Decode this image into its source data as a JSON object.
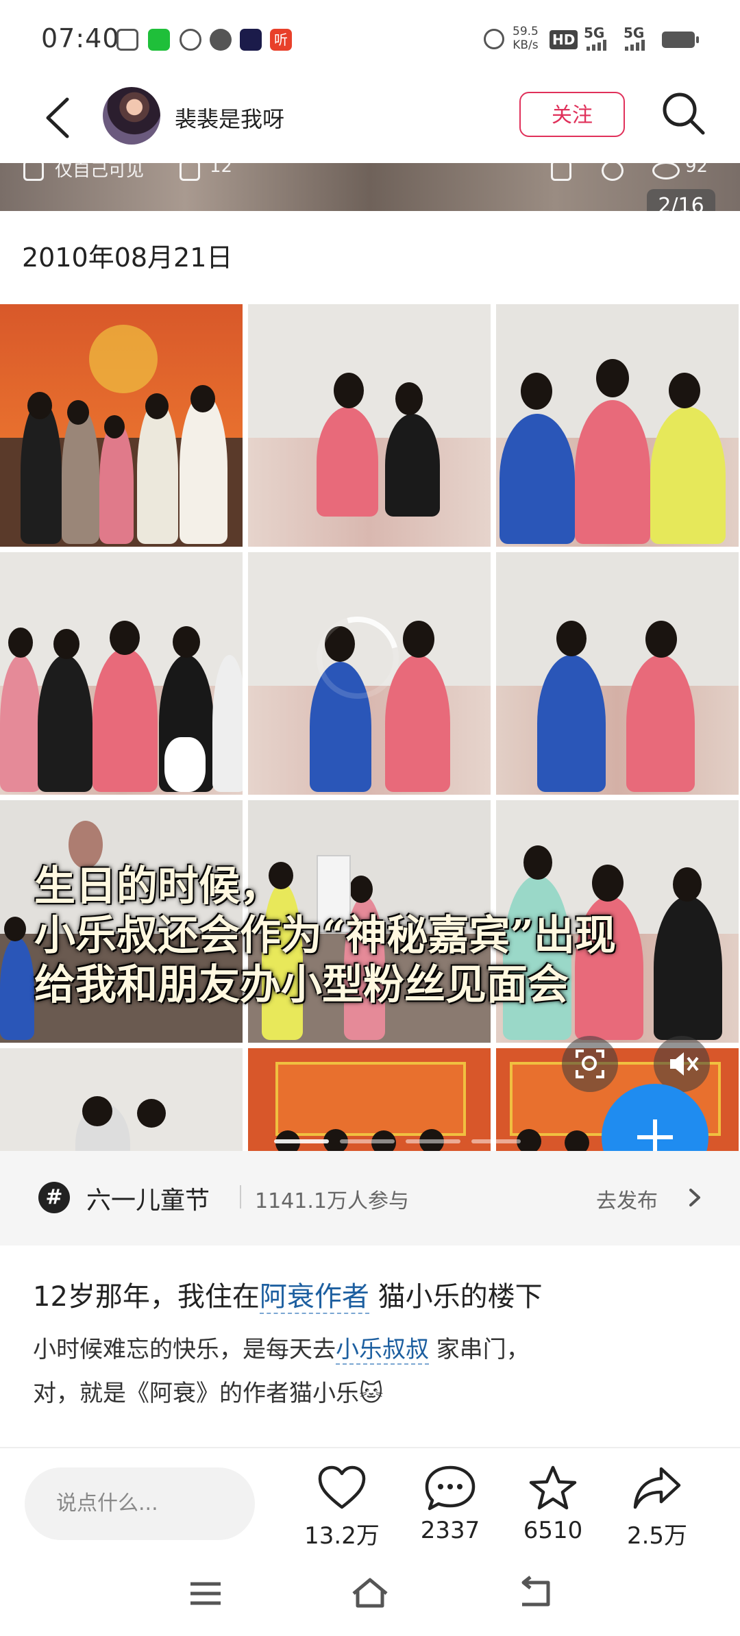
{
  "status_bar": {
    "time": "07:40",
    "net_speed": "59.5",
    "net_speed_unit": "KB/s",
    "hd_label": "HD",
    "signal_1": "5G",
    "signal_2": "5G",
    "listen_badge": "听"
  },
  "header": {
    "username": "裴裴是我呀",
    "follow_label": "关注"
  },
  "previous_post": {
    "visibility": "仅自己可见",
    "count": "12",
    "views": "92"
  },
  "gallery": {
    "counter": "2/16",
    "date": "2010年08月21日",
    "caption_lines": [
      "生日的时候，",
      "小乐叔还会作为“神秘嘉宾”出现",
      "给我和朋友办小型粉丝见面会"
    ]
  },
  "topic": {
    "icon": "#",
    "name": "六一儿童节",
    "participants": "1141.1万人参与",
    "action": "去发布"
  },
  "post": {
    "title_before": "12岁那年，我住在",
    "title_link": "阿衰作者",
    "title_after": " 猫小乐的楼下",
    "body_line1_before": "小时候难忘的快乐，是每天去",
    "body_line1_link": "小乐叔叔",
    "body_line1_after": " 家串门，",
    "body_line2": "对，就是《阿衰》的作者猫小乐🐱"
  },
  "actions": {
    "comment_placeholder": "说点什么...",
    "likes": "13.2万",
    "comments": "2337",
    "favorites": "6510",
    "shares": "2.5万"
  },
  "colors": {
    "accent": "#e0305a",
    "link": "#1d5fa0",
    "fab": "#1f8cf0"
  }
}
